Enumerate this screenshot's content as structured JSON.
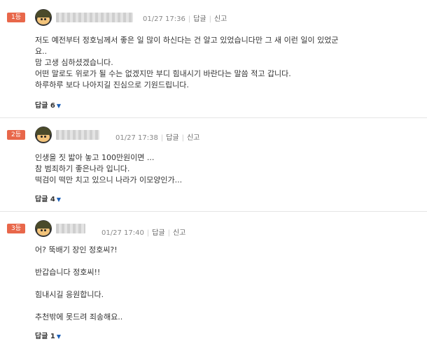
{
  "comments": [
    {
      "rank": "1등",
      "time": "01/27 17:36",
      "reply_label": "답글",
      "report_label": "신고",
      "lines": [
        "저도 예전부터 정호님께서 좋은 일 많이 하신다는 건 알고 있었습니다만 그 새 이런 일이 있었군",
        "요..",
        "맘 고생 심하셨겠습니다.",
        "어떤 말로도 위로가 될 수는 없겠지만 부디 힘내시기 바란다는 말씀 적고 갑니다.",
        "하루하루 보다 나아지길 진심으로 기원드립니다."
      ],
      "replies": "답글 6"
    },
    {
      "rank": "2등",
      "time": "01/27 17:38",
      "reply_label": "답글",
      "report_label": "신고",
      "lines": [
        "인생을 짓 밟아 놓고 100만원이면 ...",
        "참 범죄하기 좋은나라 입니다.",
        "떡검이 떡만 치고 있으니 나라가 이모양인가..."
      ],
      "replies": "답글 4"
    },
    {
      "rank": "3등",
      "time": "01/27 17:40",
      "reply_label": "답글",
      "report_label": "신고",
      "lines": [
        "어? 뚝배기 장인 정호씨?!",
        "",
        "반갑습니다 정호씨!!",
        "",
        "힘내시길 응원합니다.",
        "",
        "추천밖에 못드려 죄송해요.."
      ],
      "replies": "답글 1"
    }
  ]
}
